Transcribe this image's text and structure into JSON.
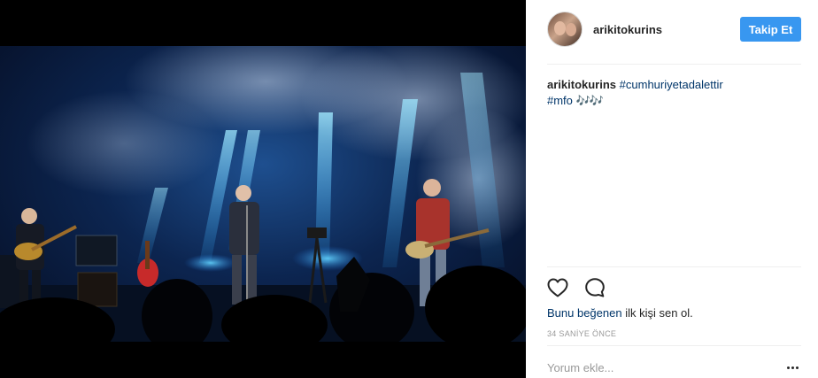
{
  "post": {
    "username": "arikitokurins",
    "follow_label": "Takip Et",
    "caption": {
      "username": "arikitokurins",
      "hashtag1": "#cumhuriyetadalettir",
      "hashtag2": "#mfo",
      "emoji": "🎶🎶"
    },
    "likes": {
      "link_text": "Bunu beğenen",
      "rest_text": " ilk kişi sen ol."
    },
    "timestamp": "34 SANİYE ÖNCE",
    "comment_placeholder": "Yorum ekle..."
  },
  "icons": {
    "like": "heart-outline-icon",
    "comment": "speech-bubble-icon",
    "more": "ellipsis-icon"
  },
  "colors": {
    "accent": "#3897f0",
    "link": "#003569",
    "muted": "#999999"
  }
}
